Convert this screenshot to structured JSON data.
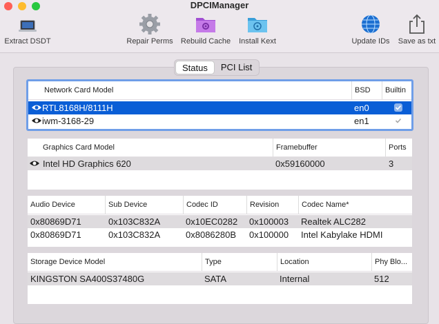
{
  "window": {
    "title": "DPCIManager"
  },
  "toolbar": {
    "extract_dsdt": "Extract DSDT",
    "repair_perms": "Repair Perms",
    "rebuild_cache": "Rebuild Cache",
    "install_kext": "Install Kext",
    "update_ids": "Update IDs",
    "save_as_txt": "Save as txt"
  },
  "tabs": {
    "status": "Status",
    "pci_list": "PCI List",
    "selected": "Status"
  },
  "network": {
    "headers": [
      "Network Card Model",
      "BSD",
      "Builtin"
    ],
    "rows": [
      {
        "model": "RTL8168H/8111H",
        "bsd": "en0",
        "builtin": true,
        "selected": true
      },
      {
        "model": "iwm-3168-29",
        "bsd": "en1",
        "builtin": true,
        "selected": false
      }
    ]
  },
  "graphics": {
    "headers": [
      "Graphics Card Model",
      "Framebuffer",
      "Ports"
    ],
    "rows": [
      {
        "model": "Intel HD Graphics 620",
        "framebuffer": "0x59160000",
        "ports": "3"
      }
    ]
  },
  "audio": {
    "headers": [
      "Audio Device",
      "Sub Device",
      "Codec ID",
      "Revision",
      "Codec Name*"
    ],
    "rows": [
      {
        "device": "0x80869D71",
        "sub": "0x103C832A",
        "codec": "0x10EC0282",
        "rev": "0x100003",
        "name": "Realtek ALC282"
      },
      {
        "device": "0x80869D71",
        "sub": "0x103C832A",
        "codec": "0x8086280B",
        "rev": "0x100000",
        "name": "Intel Kabylake HDMI"
      }
    ]
  },
  "storage": {
    "headers": [
      "Storage Device Model",
      "Type",
      "Location",
      "Phy Blo..."
    ],
    "rows": [
      {
        "model": "KINGSTON SA400S37480G",
        "type": "SATA",
        "location": "Internal",
        "block": "512"
      }
    ]
  },
  "colors": {
    "selection": "#0a5ed6",
    "focus_ring": "#6f9ee8",
    "close": "#ff5f57",
    "minimize": "#febc2e",
    "zoom": "#28c840"
  }
}
